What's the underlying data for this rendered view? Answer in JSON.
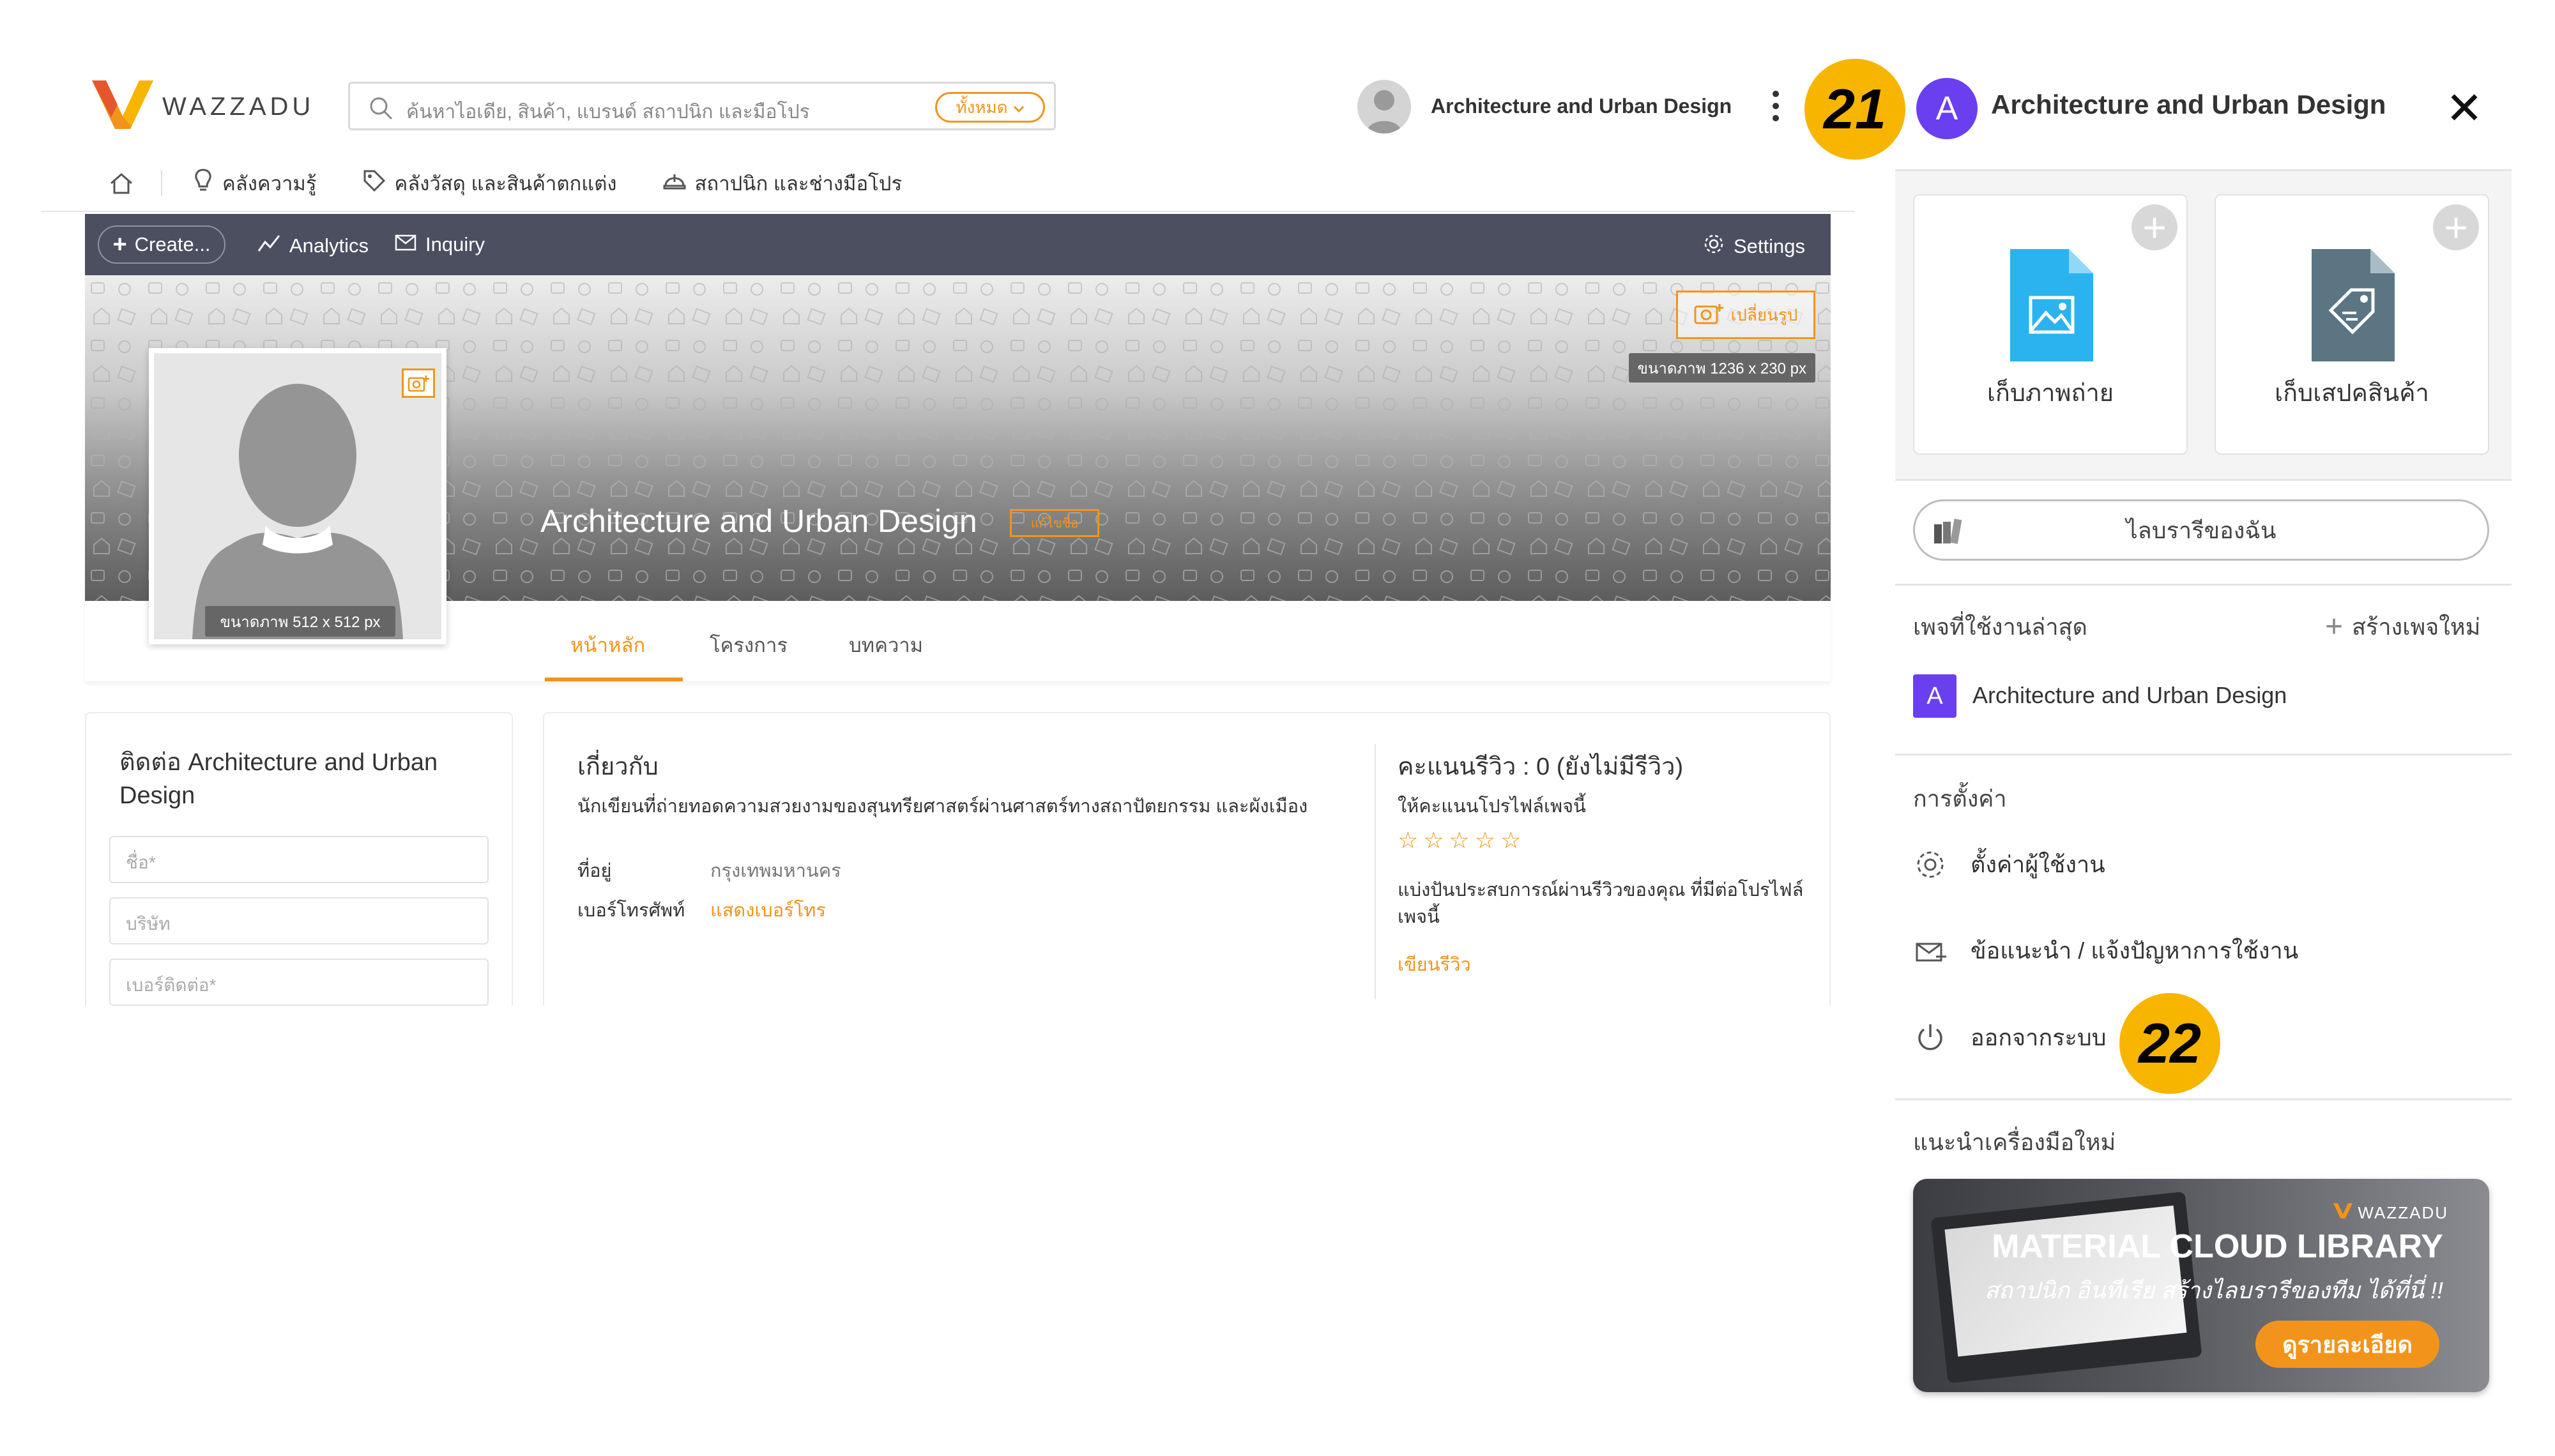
{
  "header": {
    "logo_text": "WAZZADU",
    "search_placeholder": "ค้นหาไอเดีย, สินค้า, แบรนด์ สถาปนิก และมือโปร",
    "search_scope": "ทั้งหมด",
    "user_name": "Architecture and Urban Design"
  },
  "subnav": {
    "items": [
      "คลังความรู้",
      "คลังวัสดุ และสินค้าตกแต่ง",
      "สถาปนิก และช่างมือโปร"
    ]
  },
  "toolbar": {
    "create_label": "Create...",
    "analytics_label": "Analytics",
    "inquiry_label": "Inquiry",
    "settings_label": "Settings"
  },
  "cover": {
    "change_label": "เปลี่ยนรูป",
    "size_label": "ขนาดภาพ 1236 x 230 px",
    "title": "Architecture and Urban Design",
    "badge": "แก้ไขชื่อ",
    "profile_size_label": "ขนาดภาพ 512 x 512 px"
  },
  "tabs": [
    "หน้าหลัก",
    "โครงการ",
    "บทความ"
  ],
  "contact": {
    "title": "ติดต่อ Architecture and Urban Design",
    "fields": [
      "ชื่อ*",
      "บริษัท",
      "เบอร์ติดต่อ*"
    ]
  },
  "about": {
    "title": "เกี่ยวกับ",
    "description": "นักเขียนที่ถ่ายทอดความสวยงามของสุนทรียศาสตร์ผ่านศาสตร์ทางสถาปัตยกรรม และผังเมือง",
    "address_label": "ที่อยู่",
    "address_value": "กรุงเทพมหานคร",
    "phone_label": "เบอร์โทรศัพท์",
    "phone_value": "แสดงเบอร์โทร"
  },
  "review": {
    "title": "คะแนนรีวิว : 0 (ยังไม่มีรีวิว)",
    "rate_prompt": "ให้คะแนนโปรไฟล์เพจนี้",
    "stars": "☆☆☆☆☆",
    "share_text": "แบ่งปันประสบการณ์ผ่านรีวิวของคุณ ที่มีต่อโปรไฟล์เพจนี้",
    "write_link": "เขียนรีวิว"
  },
  "callouts": {
    "first": "21",
    "second": "22"
  },
  "panel": {
    "avatar_letter": "A",
    "title": "Architecture and Urban Design",
    "quick_cards": [
      {
        "label": "เก็บภาพถ่าย",
        "icon": "image-file-icon"
      },
      {
        "label": "เก็บเสปคสินค้า",
        "icon": "tag-file-icon"
      }
    ],
    "library_label": "ไลบรารีของฉัน",
    "recent_heading": "เพจที่ใช้งานล่าสุด",
    "create_page_label": "สร้างเพจใหม่",
    "recent_pages": [
      {
        "letter": "A",
        "name": "Architecture and Urban Design"
      }
    ],
    "settings_heading": "การตั้งค่า",
    "menu": {
      "user_settings": "ตั้งค่าผู้ใช้งาน",
      "feedback": "ข้อแนะนำ / แจ้งปัญหาการใช้งาน",
      "logout": "ออกจากระบบ"
    },
    "tools_heading": "แนะนำเครื่องมือใหม่",
    "banner": {
      "brand": "WAZZADU",
      "title": "MATERIAL CLOUD LIBRARY",
      "subtitle": "สถาปนิก อินทีเรีย สร้างไลบรารีของทีม ได้ที่นี่ !!",
      "button": "ดูรายละเอียด"
    }
  },
  "colors": {
    "accent": "#f2941b",
    "toolbar_bg": "#4b4f60",
    "avatar_purple": "#6a3ff0",
    "callout_yellow": "#f7b500",
    "file_blue": "#2bb3f0",
    "file_slate": "#5b7583"
  }
}
